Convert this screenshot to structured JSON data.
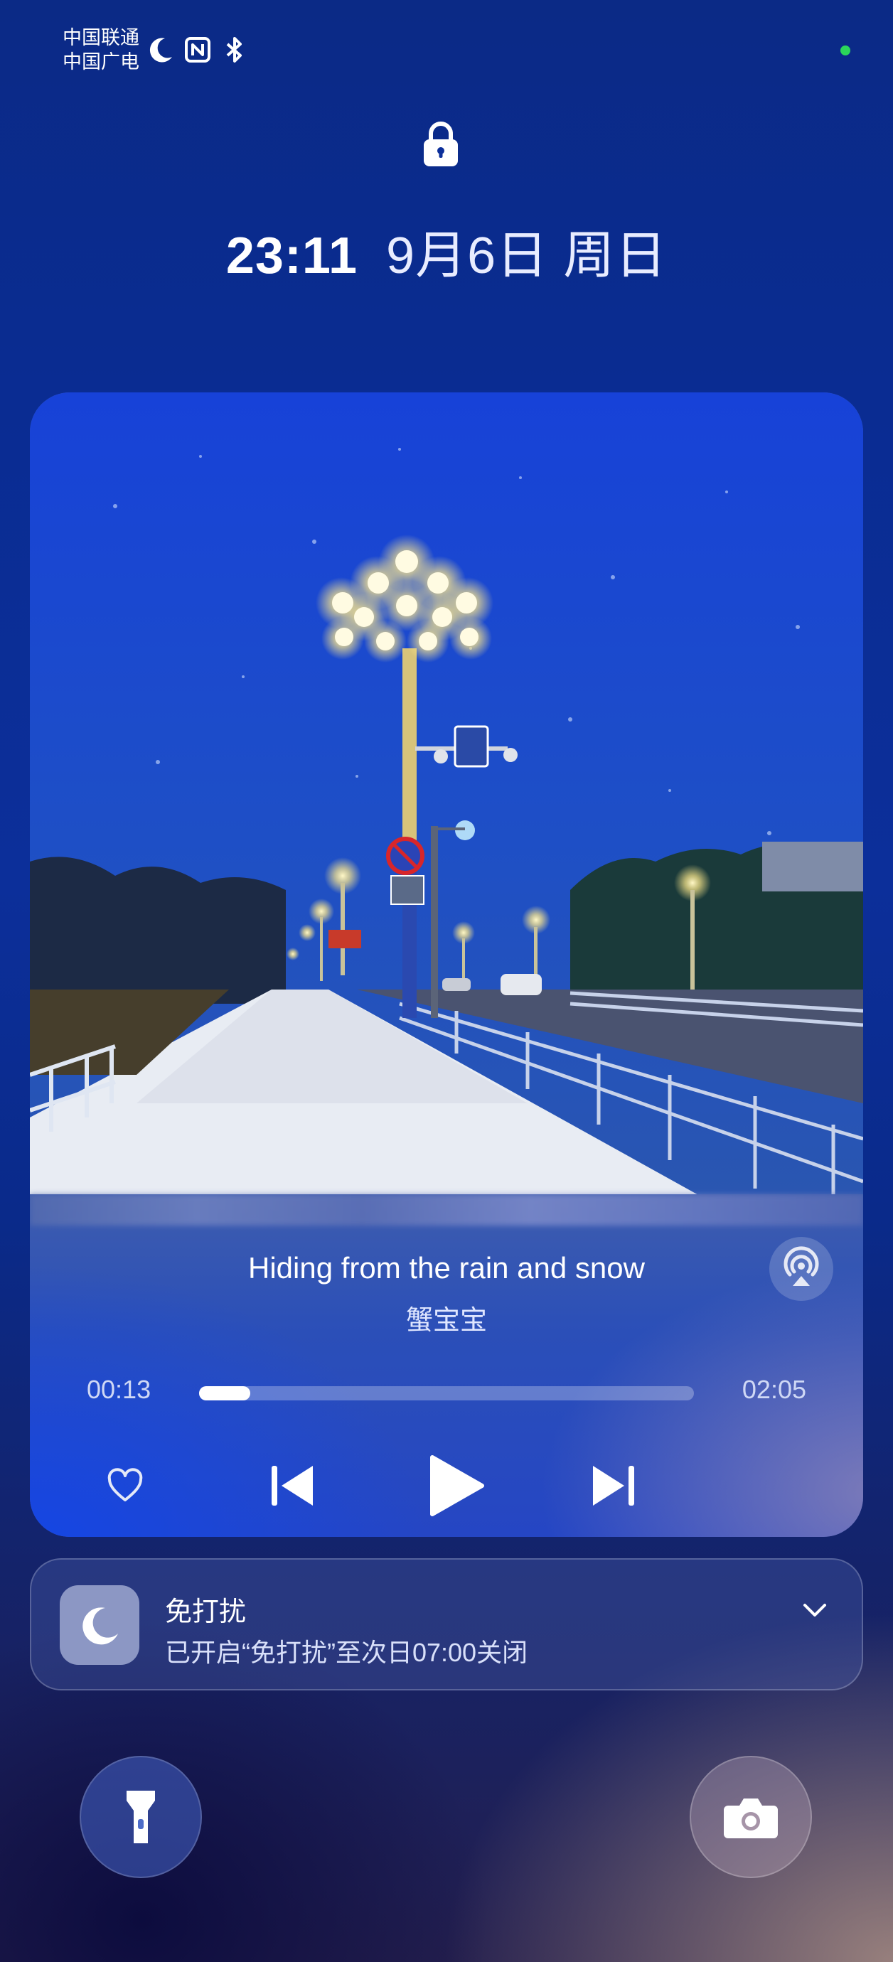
{
  "status_bar": {
    "carrier_1": "中国联通",
    "carrier_2": "中国广电",
    "icons": [
      "moon-icon",
      "nfc-icon",
      "bluetooth-icon"
    ],
    "indicator_color": "#2bd65a"
  },
  "lockscreen": {
    "lock_icon": "lock-icon",
    "time": "23:11",
    "date": "9月6日 周日"
  },
  "music_player": {
    "title": "Hiding from the rain and snow",
    "artist": "蟹宝宝",
    "elapsed": "00:13",
    "total": "02:05",
    "progress_fraction": 0.104,
    "controls": [
      "heart-icon",
      "previous-icon",
      "play-icon",
      "next-icon",
      "cast-icon"
    ]
  },
  "notification": {
    "title": "免打扰",
    "text": "已开启“免打扰”至次日07:00关闭",
    "icon": "moon-icon"
  },
  "shortcuts": {
    "left": "flashlight-icon",
    "right": "camera-icon"
  },
  "colors": {
    "background_top": "#0b2a86",
    "player_blue": "#2546c4",
    "sky": "#1d4fd6"
  }
}
